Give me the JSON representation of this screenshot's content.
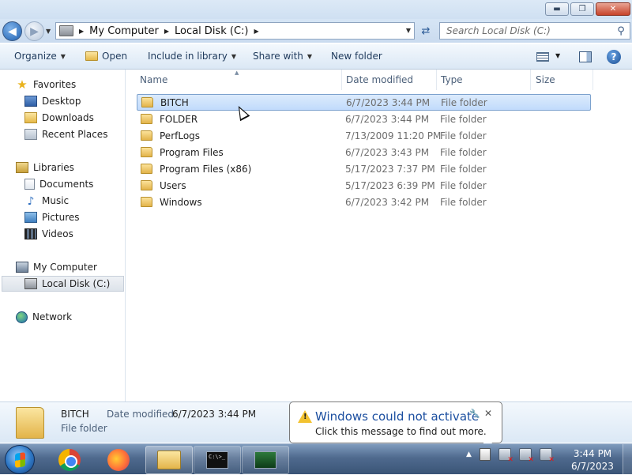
{
  "window": {
    "minimize_glyph": "▬",
    "maximize_glyph": "❐",
    "close_glyph": "✕"
  },
  "address": {
    "crumbs": [
      "My Computer",
      "Local Disk (C:)"
    ],
    "search_placeholder": "Search Local Disk (C:)"
  },
  "toolbar": {
    "organize": "Organize",
    "open": "Open",
    "include_in_library": "Include in library",
    "share_with": "Share with",
    "new_folder": "New folder"
  },
  "nav": {
    "favorites": "Favorites",
    "desktop": "Desktop",
    "downloads": "Downloads",
    "recent_places": "Recent Places",
    "libraries": "Libraries",
    "documents": "Documents",
    "music": "Music",
    "pictures": "Pictures",
    "videos": "Videos",
    "my_computer": "My Computer",
    "local_disk": "Local Disk (C:)",
    "network": "Network"
  },
  "columns": {
    "name": "Name",
    "date_modified": "Date modified",
    "type": "Type",
    "size": "Size"
  },
  "files": [
    {
      "name": "BITCH",
      "date": "6/7/2023 3:44 PM",
      "type": "File folder",
      "selected": true
    },
    {
      "name": "FOLDER",
      "date": "6/7/2023 3:44 PM",
      "type": "File folder"
    },
    {
      "name": "PerfLogs",
      "date": "7/13/2009 11:20 PM",
      "type": "File folder"
    },
    {
      "name": "Program Files",
      "date": "6/7/2023 3:43 PM",
      "type": "File folder"
    },
    {
      "name": "Program Files (x86)",
      "date": "5/17/2023 7:37 PM",
      "type": "File folder"
    },
    {
      "name": "Users",
      "date": "5/17/2023 6:39 PM",
      "type": "File folder"
    },
    {
      "name": "Windows",
      "date": "6/7/2023 3:42 PM",
      "type": "File folder"
    }
  ],
  "details": {
    "name": "BITCH",
    "type": "File folder",
    "date_label": "Date modified:",
    "date_value": "6/7/2023 3:44 PM"
  },
  "notification": {
    "title": "Windows could not activate",
    "message": "Click this message to find out more."
  },
  "taskbar": {
    "time": "3:44 PM",
    "date": "6/7/2023",
    "cmd_text": "C:\\>_"
  },
  "colors": {
    "accent": "#1c4fa0",
    "selection": "#c1dbfc",
    "taskbar": "#4f6a8e"
  }
}
